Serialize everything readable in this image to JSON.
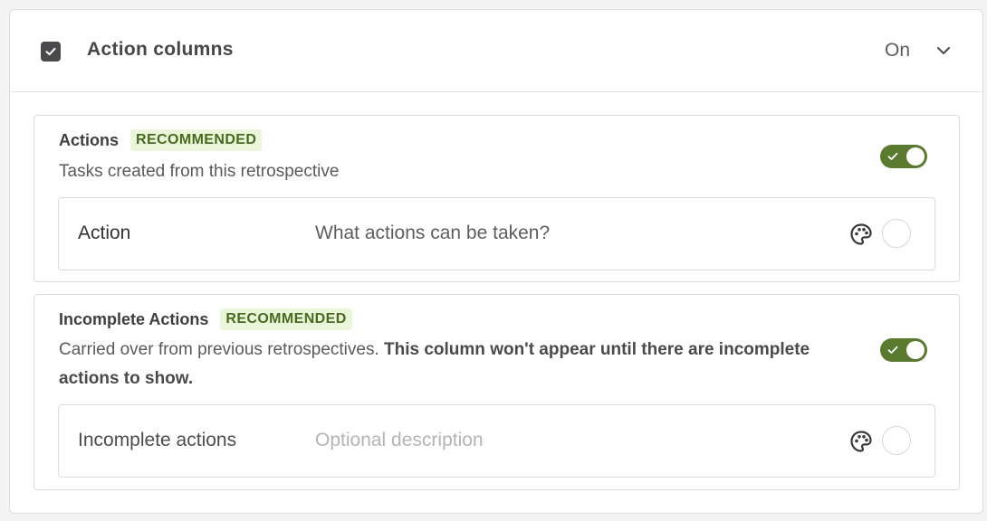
{
  "header": {
    "title": "Action columns",
    "state": "On",
    "checked": true
  },
  "cards": [
    {
      "title": "Actions",
      "badge": "RECOMMENDED",
      "description": "Tasks created from this retrospective",
      "enabled": true,
      "column": {
        "name": "Action",
        "description": "What actions can be taken?"
      }
    },
    {
      "title": "Incomplete Actions",
      "badge": "RECOMMENDED",
      "description_plain": "Carried over from previous retrospectives. ",
      "description_bold": "This column won't appear until there are incomplete actions to show.",
      "enabled": true,
      "column": {
        "name": "Incomplete actions",
        "placeholder": "Optional description"
      }
    }
  ],
  "colors": {
    "toggle_on": "#5a7a2d",
    "badge_bg": "#eaf6da",
    "badge_text": "#486a1e",
    "checkbox": "#4a4a4d"
  },
  "icons": [
    "checkbox-checked-icon",
    "chevron-down-icon",
    "check-icon",
    "palette-icon",
    "color-circle-icon"
  ]
}
